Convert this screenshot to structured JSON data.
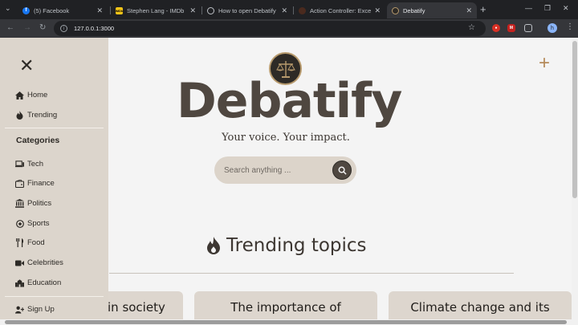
{
  "browser": {
    "tabs": [
      {
        "title": "(5) Facebook",
        "favicon": "facebook-icon"
      },
      {
        "title": "Stephen Lang - IMDb",
        "favicon": "imdb-icon"
      },
      {
        "title": "How to open Debatify",
        "favicon": "globe-icon"
      },
      {
        "title": "Action Controller: Excepti",
        "favicon": "rails-icon"
      },
      {
        "title": "Debatify",
        "favicon": "debatify-icon",
        "active": true
      }
    ],
    "url": "127.0.0.1:3000",
    "profile_initial": "h",
    "ext_label": "M"
  },
  "sidebar": {
    "top_items": [
      {
        "label": "Home",
        "icon": "home-icon"
      },
      {
        "label": "Trending",
        "icon": "fire-icon"
      }
    ],
    "categories_heading": "Categories",
    "categories": [
      {
        "label": "Tech",
        "icon": "laptop-icon"
      },
      {
        "label": "Finance",
        "icon": "wallet-icon"
      },
      {
        "label": "Politics",
        "icon": "landmark-icon"
      },
      {
        "label": "Sports",
        "icon": "ball-icon"
      },
      {
        "label": "Food",
        "icon": "utensils-icon"
      },
      {
        "label": "Celebrities",
        "icon": "video-icon"
      },
      {
        "label": "Education",
        "icon": "school-icon"
      }
    ],
    "signup_label": "Sign Up"
  },
  "hero": {
    "brand": "Debatify",
    "tagline": "Your voice. Your impact.",
    "search_placeholder": "Search anything ..."
  },
  "trending": {
    "heading": "Trending topics",
    "cards": [
      {
        "title": "in society"
      },
      {
        "title": "The importance of"
      },
      {
        "title": "Climate change and its"
      }
    ]
  },
  "colors": {
    "brand": "#4f4740",
    "accent": "#b58a5a",
    "sidebar_bg": "#dcd5cc",
    "page_bg": "#f4f4f4"
  }
}
